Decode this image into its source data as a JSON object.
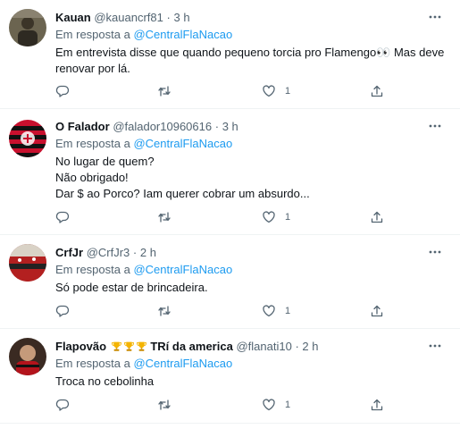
{
  "tweets": [
    {
      "name": "Kauan",
      "handle": "@kauancrf81",
      "dot": "·",
      "time": "3 h",
      "replying_prefix": "Em resposta a ",
      "replying_to": "@CentralFlaNacao",
      "lines": [
        "Em entrevista disse que quando pequeno torcia pro Flamengo👀 Mas deve",
        "renovar por lá."
      ],
      "like_count": "1"
    },
    {
      "name": "O Falador",
      "handle": "@falador10960616",
      "dot": "·",
      "time": "3 h",
      "replying_prefix": "Em resposta a ",
      "replying_to": "@CentralFlaNacao",
      "lines": [
        "No lugar de quem?",
        "Não obrigado!",
        "Dar $ ao Porco? Iam querer cobrar um absurdo..."
      ],
      "like_count": "1"
    },
    {
      "name": "CrfJr",
      "handle": "@CrfJr3",
      "dot": "·",
      "time": "2 h",
      "replying_prefix": "Em resposta a ",
      "replying_to": "@CentralFlaNacao",
      "lines": [
        "Só pode estar de brincadeira."
      ],
      "like_count": "1"
    },
    {
      "name": "Flapovão",
      "name_suffix": "TRí da america",
      "handle": "@flanati10",
      "dot": "·",
      "time": "2 h",
      "replying_prefix": "Em resposta a ",
      "replying_to": "@CentralFlaNacao",
      "lines": [
        "Troca no cebolinha"
      ],
      "like_count": "1"
    }
  ],
  "icons": {
    "more": "more-dots-icon",
    "reply": "reply-icon",
    "retweet": "retweet-icon",
    "like": "heart-icon",
    "share": "share-icon",
    "trophy": "trophy-icon"
  },
  "colors": {
    "text": "#0f1419",
    "secondary": "#536471",
    "link": "#1d9bf0",
    "divider": "#eff3f4"
  }
}
